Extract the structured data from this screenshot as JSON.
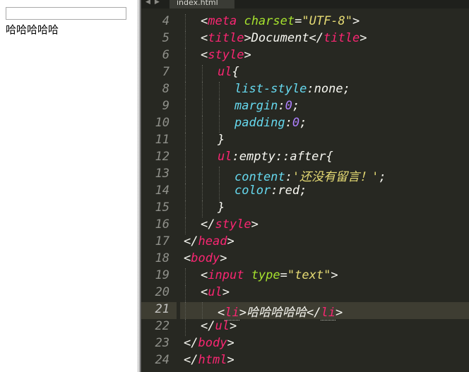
{
  "preview": {
    "input_value": "",
    "list_items": [
      "哈哈哈哈哈"
    ]
  },
  "editor": {
    "nav_back": "◀",
    "nav_forward": "▶",
    "tab_title": "index.html",
    "active_line": 21,
    "lines": [
      {
        "num": "4",
        "indent": 1,
        "tokens": [
          [
            "p",
            "<"
          ],
          [
            "t",
            "meta"
          ],
          [
            "p",
            " "
          ],
          [
            "a",
            "charset"
          ],
          [
            "p",
            "="
          ],
          [
            "s",
            "\"UTF-8\""
          ],
          [
            "p",
            ">"
          ]
        ]
      },
      {
        "num": "5",
        "indent": 1,
        "tokens": [
          [
            "p",
            "<"
          ],
          [
            "t",
            "title"
          ],
          [
            "p",
            ">Document</"
          ],
          [
            "t",
            "title"
          ],
          [
            "p",
            ">"
          ]
        ]
      },
      {
        "num": "6",
        "indent": 1,
        "tokens": [
          [
            "p",
            "<"
          ],
          [
            "t",
            "style"
          ],
          [
            "p",
            ">"
          ]
        ]
      },
      {
        "num": "7",
        "indent": 2,
        "tokens": [
          [
            "t",
            "ul"
          ],
          [
            "p",
            "{"
          ]
        ]
      },
      {
        "num": "8",
        "indent": 3,
        "tokens": [
          [
            "pr",
            "list-style"
          ],
          [
            "p",
            ":"
          ],
          [
            "p",
            "none"
          ],
          [
            "p",
            ";"
          ]
        ]
      },
      {
        "num": "9",
        "indent": 3,
        "tokens": [
          [
            "pr",
            "margin"
          ],
          [
            "p",
            ":"
          ],
          [
            "n",
            "0"
          ],
          [
            "p",
            ";"
          ]
        ]
      },
      {
        "num": "10",
        "indent": 3,
        "tokens": [
          [
            "pr",
            "padding"
          ],
          [
            "p",
            ":"
          ],
          [
            "n",
            "0"
          ],
          [
            "p",
            ";"
          ]
        ]
      },
      {
        "num": "11",
        "indent": 2,
        "tokens": [
          [
            "p",
            "}"
          ]
        ]
      },
      {
        "num": "12",
        "indent": 2,
        "tokens": [
          [
            "t",
            "ul"
          ],
          [
            "p",
            ":empty::after{"
          ]
        ]
      },
      {
        "num": "13",
        "indent": 3,
        "tokens": [
          [
            "pr",
            "content"
          ],
          [
            "p",
            ":"
          ],
          [
            "s",
            "'还没有留言！'"
          ],
          [
            "p",
            ";"
          ]
        ]
      },
      {
        "num": "14",
        "indent": 3,
        "tokens": [
          [
            "pr",
            "color"
          ],
          [
            "p",
            ":"
          ],
          [
            "p",
            "red"
          ],
          [
            "p",
            ";"
          ]
        ]
      },
      {
        "num": "15",
        "indent": 2,
        "tokens": [
          [
            "p",
            "}"
          ]
        ]
      },
      {
        "num": "16",
        "indent": 1,
        "tokens": [
          [
            "p",
            "</"
          ],
          [
            "t",
            "style"
          ],
          [
            "p",
            ">"
          ]
        ]
      },
      {
        "num": "17",
        "indent": 0,
        "tokens": [
          [
            "p",
            "</"
          ],
          [
            "t",
            "head"
          ],
          [
            "p",
            ">"
          ]
        ]
      },
      {
        "num": "18",
        "indent": 0,
        "tokens": [
          [
            "p",
            "<"
          ],
          [
            "t",
            "body"
          ],
          [
            "p",
            ">"
          ]
        ]
      },
      {
        "num": "19",
        "indent": 1,
        "tokens": [
          [
            "p",
            "<"
          ],
          [
            "t",
            "input"
          ],
          [
            "p",
            " "
          ],
          [
            "a",
            "type"
          ],
          [
            "p",
            "="
          ],
          [
            "s",
            "\"text\""
          ],
          [
            "p",
            ">"
          ]
        ]
      },
      {
        "num": "20",
        "indent": 1,
        "tokens": [
          [
            "p",
            "<"
          ],
          [
            "t",
            "ul"
          ],
          [
            "p",
            ">"
          ]
        ]
      },
      {
        "num": "21",
        "indent": 2,
        "tokens": [
          [
            "p",
            "<"
          ],
          [
            "t li-under",
            "li"
          ],
          [
            "p",
            ">哈哈哈哈哈</"
          ],
          [
            "t li-under",
            "li"
          ],
          [
            "p",
            ">"
          ]
        ]
      },
      {
        "num": "22",
        "indent": 1,
        "tokens": [
          [
            "p",
            "</"
          ],
          [
            "t",
            "ul"
          ],
          [
            "p",
            ">"
          ]
        ]
      },
      {
        "num": "23",
        "indent": 0,
        "tokens": [
          [
            "p",
            "</"
          ],
          [
            "t",
            "body"
          ],
          [
            "p",
            ">"
          ]
        ]
      },
      {
        "num": "24",
        "indent": 0,
        "tokens": [
          [
            "p",
            "</"
          ],
          [
            "t",
            "html"
          ],
          [
            "p",
            ">"
          ]
        ]
      }
    ]
  }
}
